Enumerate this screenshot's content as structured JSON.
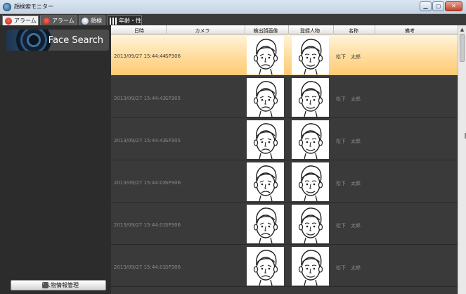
{
  "window": {
    "title": "顔検索モニター",
    "buttons": [
      "minimize",
      "maximize",
      "close"
    ]
  },
  "tabs": [
    {
      "label": "アラーム",
      "icon": "alarm-icon",
      "state": "active"
    },
    {
      "label": "アラーム検索",
      "icon": "alarm-search-icon",
      "state": "inactive"
    },
    {
      "label": "顔検索",
      "icon": "face-search-icon",
      "state": "inactive"
    },
    {
      "label": "年齢・性別",
      "icon": "bar-chart-icon",
      "state": "inactive"
    }
  ],
  "sidebar": {
    "brand": "Face Search",
    "manage_button": "人物情報管理"
  },
  "table": {
    "columns": [
      "日時",
      "カメラ",
      "検出顔画像",
      "登録人物",
      "名称",
      "備考"
    ],
    "rows": [
      {
        "datetime": "2013/09/27 15:44:44",
        "camera": "SP306",
        "name": "松下　太郎",
        "remarks": "",
        "selected": true
      },
      {
        "datetime": "2013/09/27 15:44:43",
        "camera": "SP305",
        "name": "松下　太郎",
        "remarks": "",
        "selected": false
      },
      {
        "datetime": "2013/09/27 15:44:43",
        "camera": "SP305",
        "name": "松下　太郎",
        "remarks": "",
        "selected": false
      },
      {
        "datetime": "2013/09/27 15:44:03",
        "camera": "SP306",
        "name": "松下　太郎",
        "remarks": "",
        "selected": false
      },
      {
        "datetime": "2013/09/27 15:44:01",
        "camera": "SP306",
        "name": "松下　太郎",
        "remarks": "",
        "selected": false
      },
      {
        "datetime": "2013/09/27 15:44:01",
        "camera": "SP306",
        "name": "松下　太郎",
        "remarks": "",
        "selected": false
      }
    ]
  },
  "colors": {
    "selected_row": "#ffd891",
    "background": "#3a3a3a",
    "sidebar": "#2c2c2c"
  },
  "icons": {
    "detected_face": "frowning-face-sketch-icon",
    "registered_face": "smiling-face-sketch-icon"
  }
}
